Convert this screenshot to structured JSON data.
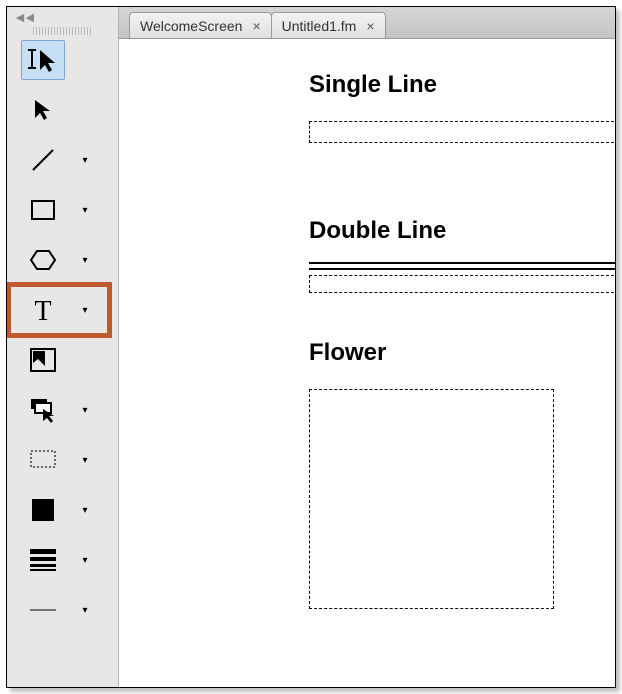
{
  "tabs": [
    {
      "label": "WelcomeScreen"
    },
    {
      "label": "Untitled1.fm"
    }
  ],
  "doc": {
    "h1": "Single Line",
    "h2": "Double Line",
    "h3": "Flower"
  },
  "tools": {
    "collapse": "◄◄"
  }
}
